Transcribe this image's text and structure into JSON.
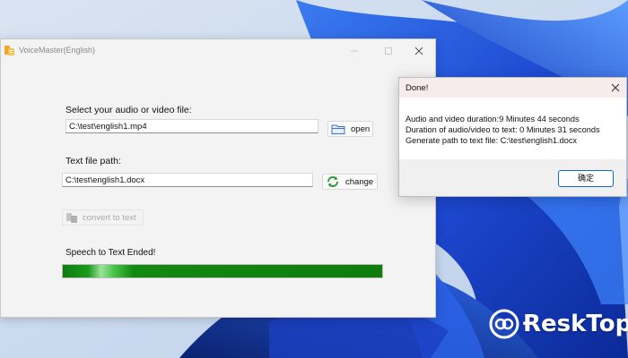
{
  "colors": {
    "accent": "#0f6cbd",
    "progress_green": "#118411",
    "wallpaper_blue": "#1f4fd6"
  },
  "main_window": {
    "title": "VoiceMaster(English)",
    "icons": {
      "app": "voicemaster-app-icon",
      "minimize": "minimize-icon",
      "maximize": "maximize-icon",
      "close": "close-icon"
    },
    "audio_section": {
      "label": "Select your audio or video file:",
      "file_path": "C:\\test\\english1.mp4",
      "open_label": "open",
      "open_icon": "folder-icon"
    },
    "text_section": {
      "label": "Text file path:",
      "file_path": "C:\\test\\english1.docx",
      "change_label": "change",
      "change_icon": "refresh-icon"
    },
    "convert_label": "convert to text",
    "convert_icon": "convert-icon",
    "status_text": "Speech to Text Ended!",
    "progress_fraction": 1.0
  },
  "dialog": {
    "title": "Done!",
    "lines": [
      "Audio and video duration:9 Minutes 44 seconds",
      "Duration of audio/video to text: 0 Minutes 31 seconds",
      "Generate path to text file: C:\\test\\english1.docx"
    ],
    "ok_label": "确定",
    "close_icon": "close-icon"
  },
  "watermark": {
    "text": "ɌeskTop",
    "logo_icon": "desktop-logo-icon"
  }
}
